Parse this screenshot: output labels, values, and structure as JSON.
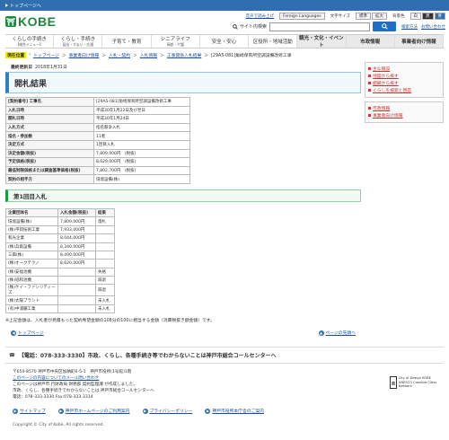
{
  "topbar": {
    "label": "トップページへ"
  },
  "header": {
    "logo_text": "KOBE",
    "util": {
      "listen": "音声で読み上げ",
      "foreign": "Foreign Languages",
      "font_size": "文字サイズ",
      "sizes": [
        "標準",
        "拡大"
      ],
      "color": "背景色",
      "colors": [
        "白",
        "黒",
        "青"
      ]
    },
    "search_label": "サイト内検索",
    "search_placeholder": "",
    "search_button": "検索",
    "search_method": "検索方法",
    "search_help": "お問い合わせ"
  },
  "nav": [
    {
      "label": "くらしの手続き",
      "sub": "【総合メニュー】"
    },
    {
      "label": "くらし・手続き",
      "sub": "届出・すまい・交通"
    },
    {
      "label": "子育て・教育",
      "sub": ""
    },
    {
      "label": "シニアライフ",
      "sub": "高齢・介護"
    },
    {
      "label": "安全・安心",
      "sub": ""
    },
    {
      "label": "区役所・地域活動",
      "sub": ""
    },
    {
      "label": "観光・文化・イベント",
      "sub": ""
    },
    {
      "label": "市政情報",
      "sub": ""
    },
    {
      "label": "事業者向け情報",
      "sub": ""
    }
  ],
  "breadcrumb": {
    "here": "現在位置",
    "items": [
      "トップページ",
      "事業者向け情報",
      "入札・契約",
      "入札情報",
      "工事関係入札結果"
    ],
    "current": "[29A5-081]角崎保育所空調設備改修工事"
  },
  "updated": {
    "label": "最終更新日",
    "date": "2018年1月31日"
  },
  "page_title": "開札結果",
  "info_rows": [
    {
      "key": "[契約番号] 工事名",
      "value": "[29A5-081]角崎保育所空調設備改修工事"
    },
    {
      "key": "入札日時",
      "value": "平成30年1月22日及び翌日"
    },
    {
      "key": "開札日時",
      "value": "平成30年1月24日"
    },
    {
      "key": "入札方式",
      "value": "指名競争入札"
    },
    {
      "key": "指名・参加数",
      "value": "11者"
    },
    {
      "key": "決定方式",
      "value": "1回目入札"
    },
    {
      "key": "決定金額(税抜)",
      "value": "7,809,000円　(税抜)"
    },
    {
      "key": "予定価格(税抜)",
      "value": "8,629,000円　(税抜)"
    },
    {
      "key": "最低制限価格または調査基準価格(税抜)",
      "value": "7,802,700円　(税抜)"
    },
    {
      "key": "契約の相手方",
      "value": "環境設備(株)"
    }
  ],
  "round_title": "第1回目入札",
  "bid_headers": [
    "企業団体名",
    "入札金額(税抜)",
    "結果"
  ],
  "bids": [
    [
      "環境設備(株)",
      "7,809,000円",
      "落札"
    ],
    [
      "(株)平岡技術工業",
      "7,933,000円",
      ""
    ],
    [
      "和光企業",
      "8,044,000円",
      ""
    ],
    [
      "(株)兵衛設備",
      "8,340,000円",
      ""
    ],
    [
      "三興(株)",
      "8,490,000円",
      ""
    ],
    [
      "(株)オークテクノ",
      "8,620,000円",
      ""
    ],
    [
      "(株)安福池機",
      "",
      "失格"
    ],
    [
      "(株)協和池機",
      "",
      "辞退"
    ],
    [
      "(株)ケイ・ファシリティーズ",
      "",
      "辞退"
    ],
    [
      "(株)太陽プラント",
      "",
      "未入札"
    ],
    [
      "(有)中浦醸工業",
      "",
      "未入札"
    ]
  ],
  "note": "※上記金額は、入札者が見積もった契約希望金額の108分の100に相当する金額（消費税抜き額金額）です。",
  "pager": {
    "prev": "トップページ",
    "next": "ページの先頭へ"
  },
  "side": {
    "box1": [
      "主な施設",
      "地図から探す",
      "組織から探す",
      "くらしを検索と回答"
    ],
    "box2": [
      "市政情報",
      "事業者向け情報"
    ]
  },
  "footer": {
    "call": "【電話：078-333-3330】市政、くらし、各種手続き等でわからないことは神戸市総合コールセンターへ",
    "address": "〒650-8570 神戸市中央区加納町6-5-1　神戸市役所(1号館)1階",
    "line2": "このページの内容についてのメール問い合わせ",
    "line3": "このページは神戸市 行財政局 財務部 契約監理課 が作成しました。",
    "line4": "市政、くらし、各種手続きでわからないことは 神戸市総合コールセンターへ",
    "line5": "電話：078-333-3330 Fax:078-333-3314",
    "unesco": "City of Design KOBE UNESCO Creative Cities Network",
    "links": [
      "サイトマップ",
      "神戸市ホームページのご利用案内",
      "プライバシーポリシー",
      "神戸市役所本庁舎のご案内"
    ],
    "copyright": "Copyright © City of Kobe. All rights reserved."
  }
}
